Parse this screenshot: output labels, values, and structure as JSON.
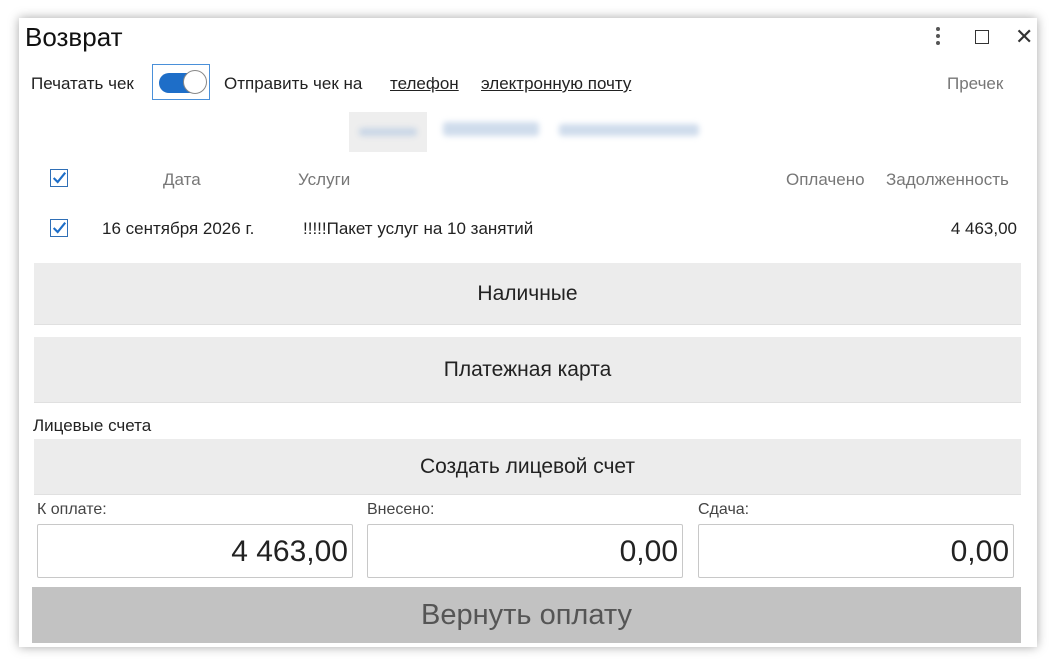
{
  "window": {
    "title": "Возврат"
  },
  "receipt": {
    "print_label": "Печатать чек",
    "print_enabled": true,
    "send_label": "Отправить чек на",
    "phone_link": "телефон",
    "email_link": "электронную почту",
    "precheck": "Пречек"
  },
  "table": {
    "headers": {
      "date": "Дата",
      "services": "Услуги",
      "paid": "Оплачено",
      "debt": "Задолженность"
    },
    "rows": [
      {
        "date": "16 сентября 2026 г.",
        "service": "!!!!!Пакет услуг на 10 занятий",
        "paid": "",
        "debt": "4 463,00",
        "checked": true
      }
    ]
  },
  "payment": {
    "cash": "Наличные",
    "card": "Платежная карта",
    "accounts_label": "Лицевые счета",
    "create_account": "Создать лицевой счет"
  },
  "totals": {
    "to_pay_label": "К оплате:",
    "to_pay": "4 463,00",
    "deposited_label": "Внесено:",
    "deposited": "0,00",
    "change_label": "Сдача:",
    "change": "0,00"
  },
  "submit_label": "Вернуть оплату",
  "colors": {
    "accent": "#1e6ec8",
    "button_bg": "#ececec",
    "submit_bg": "#c2c2c2"
  }
}
